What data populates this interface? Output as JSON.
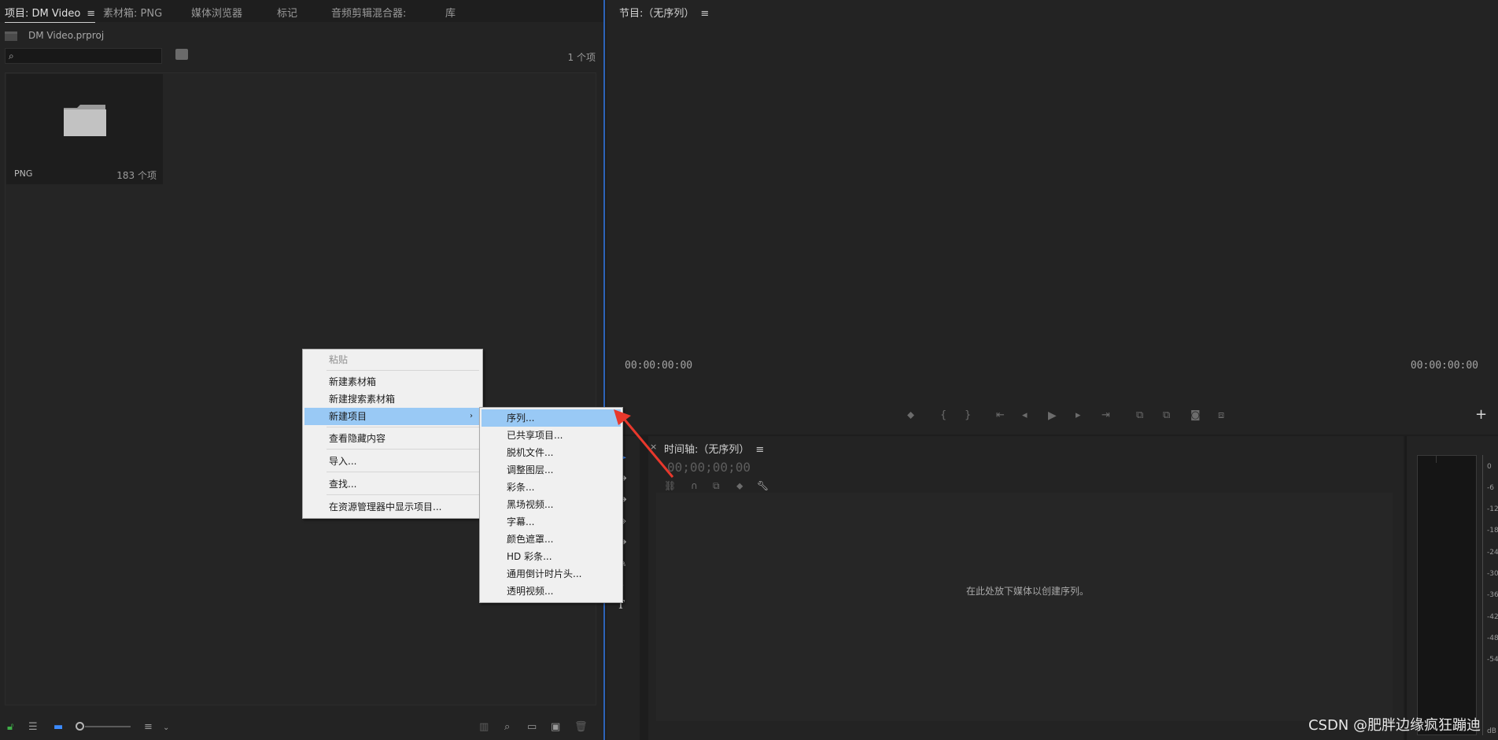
{
  "project_panel": {
    "tabs": [
      "项目: DM Video",
      "素材箱: PNG",
      "媒体浏览器",
      "标记",
      "音频剪辑混合器:",
      "库"
    ],
    "menu_glyph": "≡",
    "project_file": "DM Video.prproj",
    "search_placeholder": "",
    "item_count": "1 个项",
    "bin": {
      "name": "PNG",
      "count": "183 个项"
    }
  },
  "program_monitor": {
    "title": "节目:（无序列）",
    "menu_glyph": "≡",
    "timecode_left": "00:00:00:00",
    "timecode_right": "00:00:00:00",
    "add_glyph": "+"
  },
  "timeline": {
    "close_glyph": "×",
    "title": "时间轴:（无序列）",
    "menu_glyph": "≡",
    "timecode": "00;00;00;00",
    "drop_hint": "在此处放下媒体以创建序列。"
  },
  "meters": {
    "scale": [
      "0",
      "-6",
      "-12",
      "-18",
      "-24",
      "-30",
      "-36",
      "-42",
      "-48",
      "-54",
      "dB"
    ]
  },
  "context_menu": {
    "items": [
      "粘贴",
      "新建素材箱",
      "新建搜索素材箱",
      "新建项目",
      "查看隐藏内容",
      "导入...",
      "查找...",
      "在资源管理器中显示项目..."
    ],
    "submenu_arrow": "›"
  },
  "submenu": {
    "items": [
      "序列...",
      "已共享项目...",
      "脱机文件...",
      "调整图层...",
      "彩条...",
      "黑场视频...",
      "字幕...",
      "颜色遮罩...",
      "HD 彩条...",
      "通用倒计时片头...",
      "透明视频..."
    ]
  },
  "watermark": "CSDN @肥胖边缘疯狂蹦迪",
  "colors": {
    "accent": "#2d63b8",
    "highlight": "#99c9f5",
    "annotation": "#e8382c",
    "tool_active": "#3c8bff"
  }
}
